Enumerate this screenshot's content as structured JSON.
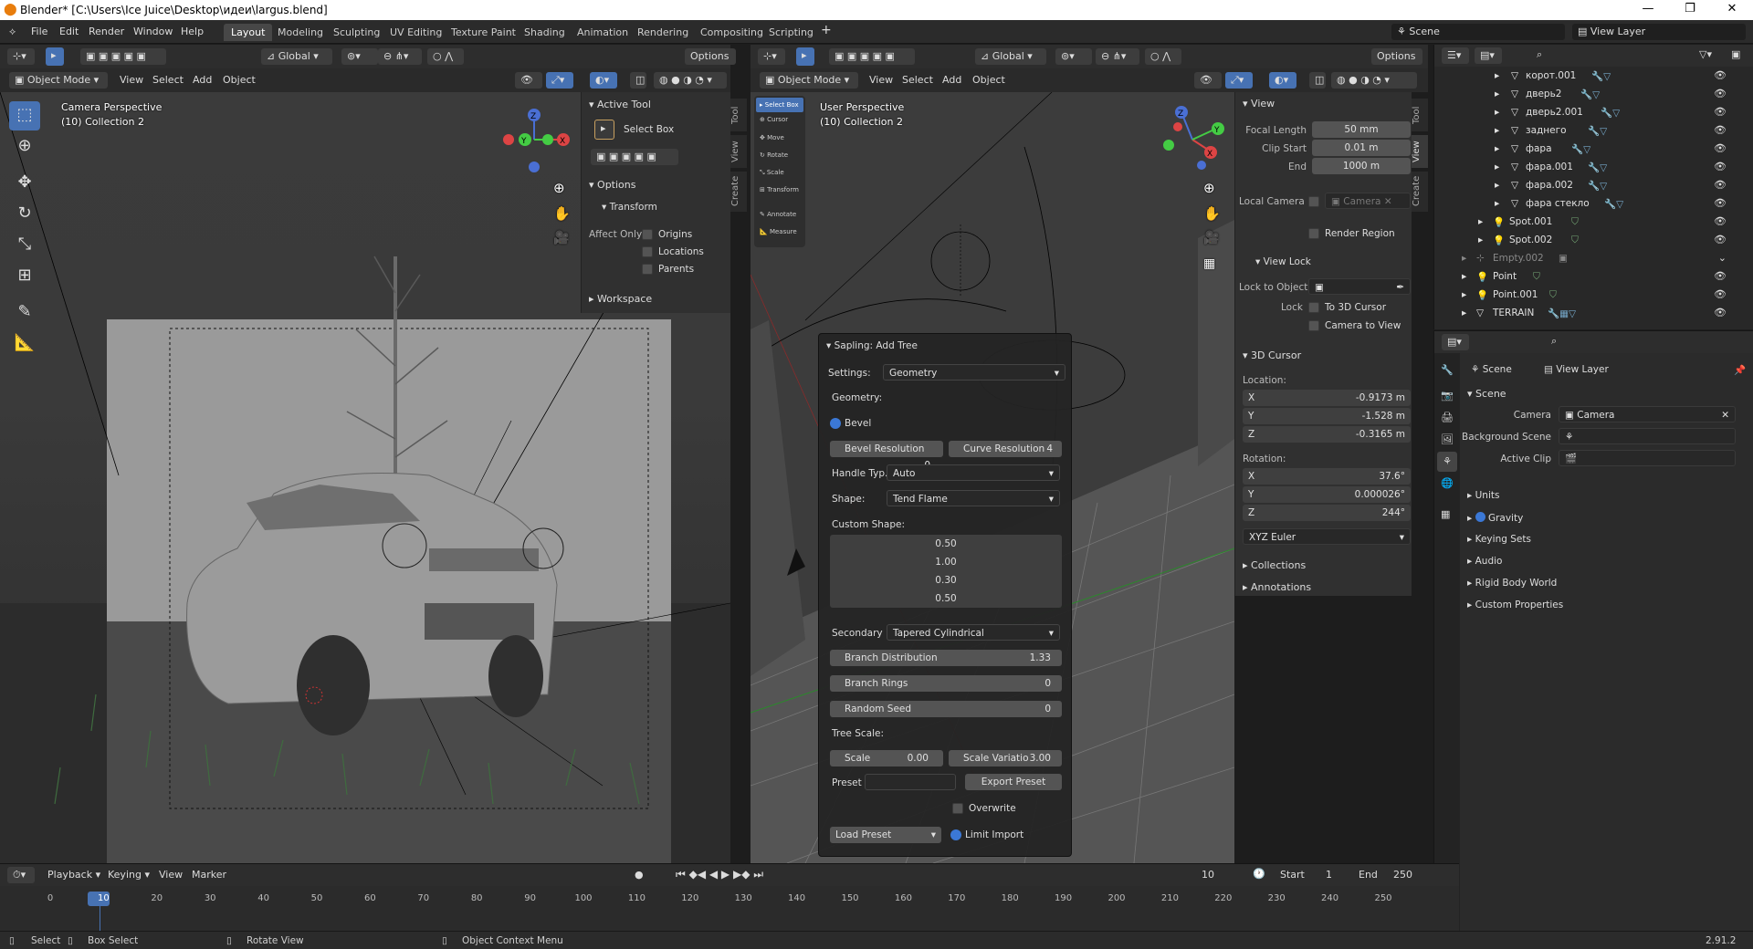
{
  "window": {
    "title": "Blender* [C:\\Users\\Ice Juice\\Desktop\\идеи\\largus.blend]",
    "min_icon": "minimize-icon",
    "max_icon": "maximize-icon",
    "close_icon": "close-icon"
  },
  "menu": {
    "items": [
      "File",
      "Edit",
      "Render",
      "Window",
      "Help"
    ]
  },
  "workspaces": [
    "Layout",
    "Modeling",
    "Sculpting",
    "UV Editing",
    "Texture Paint",
    "Shading",
    "Animation",
    "Rendering",
    "Compositing",
    "Scripting"
  ],
  "top_right": {
    "scene": "Scene",
    "view_layer": "View Layer"
  },
  "left_viewport": {
    "transform": "Global",
    "options": "Options",
    "mode": "Object Mode",
    "menus": [
      "View",
      "Select",
      "Add",
      "Object"
    ],
    "perspective": "Camera Perspective",
    "collection": "(10) Collection 2",
    "tool_panel": {
      "active_tool": "Active Tool",
      "select_box": "Select Box",
      "options": "Options",
      "transform": "Transform",
      "affect_only": "Affect Only",
      "origins": "Origins",
      "locations": "Locations",
      "parents": "Parents",
      "workspace": "Workspace"
    },
    "tabs": [
      "Tool",
      "View",
      "Create"
    ]
  },
  "right_viewport": {
    "transform": "Global",
    "options": "Options",
    "mode": "Object Mode",
    "menus": [
      "View",
      "Select",
      "Add",
      "Object"
    ],
    "perspective": "User Perspective",
    "collection": "(10) Collection 2",
    "mini_tools": [
      "Select Box",
      "Cursor",
      "Move",
      "Rotate",
      "Scale",
      "Transform",
      "Annotate",
      "Measure"
    ],
    "view_panel": {
      "view": "View",
      "focal_length_label": "Focal Length",
      "focal_length": "50 mm",
      "clip_start_label": "Clip Start",
      "clip_start": "0.01 m",
      "end_label": "End",
      "end": "1000 m",
      "local_camera_label": "Local Camera",
      "local_camera": "Camera",
      "render_region": "Render Region",
      "view_lock": "View Lock",
      "lock_to_object_label": "Lock to Object",
      "lock_label": "Lock",
      "to_3d_cursor": "To 3D Cursor",
      "camera_to_view": "Camera to View",
      "cursor_3d": "3D Cursor",
      "location_label": "Location:",
      "loc": [
        {
          "axis": "X",
          "val": "-0.9173 m"
        },
        {
          "axis": "Y",
          "val": "-1.528 m"
        },
        {
          "axis": "Z",
          "val": "-0.3165 m"
        }
      ],
      "rotation_label": "Rotation:",
      "rot": [
        {
          "axis": "X",
          "val": "37.6°"
        },
        {
          "axis": "Y",
          "val": "0.000026°"
        },
        {
          "axis": "Z",
          "val": "244°"
        }
      ],
      "rot_mode": "XYZ Euler",
      "collections": "Collections",
      "annotations": "Annotations"
    },
    "tabs": [
      "Tool",
      "View",
      "Create"
    ]
  },
  "sapling": {
    "title": "Sapling: Add Tree",
    "settings_label": "Settings:",
    "settings": "Geometry",
    "geometry_label": "Geometry:",
    "bevel": "Bevel",
    "bevel_resolution": "Bevel Resolution",
    "bevel_resolution_val": "0",
    "curve_resolution": "Curve Resolution",
    "curve_resolution_val": "4",
    "handle_type_label": "Handle Typ...",
    "handle_type": "Auto",
    "shape_label": "Shape:",
    "shape": "Tend Flame",
    "custom_shape_label": "Custom Shape:",
    "custom_shape": [
      "0.50",
      "1.00",
      "0.30",
      "0.50"
    ],
    "secondary_label": "Secondary",
    "secondary": "Tapered Cylindrical",
    "branch_distribution": "Branch Distribution",
    "branch_distribution_val": "1.33",
    "branch_rings": "Branch Rings",
    "branch_rings_val": "0",
    "random_seed": "Random Seed",
    "random_seed_val": "0",
    "tree_scale_label": "Tree Scale:",
    "scale": "Scale",
    "scale_val": "0.00",
    "scale_variation": "Scale Variatio",
    "scale_variation_val": "3.00",
    "preset_label": "Preset",
    "export_preset": "Export Preset",
    "overwrite": "Overwrite",
    "load_preset": "Load Preset",
    "limit_import": "Limit Import"
  },
  "outliner": {
    "items": [
      {
        "name": "корот.001",
        "indent": 3,
        "eye": "👁"
      },
      {
        "name": "дверь2",
        "indent": 3,
        "eye": "👁"
      },
      {
        "name": "дверь2.001",
        "indent": 3,
        "eye": "👁"
      },
      {
        "name": "заднего",
        "indent": 3,
        "eye": "👁"
      },
      {
        "name": "фара",
        "indent": 3,
        "eye": "👁"
      },
      {
        "name": "фара.001",
        "indent": 3,
        "eye": "👁"
      },
      {
        "name": "фара.002",
        "indent": 3,
        "eye": "👁"
      },
      {
        "name": "фара стекло",
        "indent": 3,
        "eye": "👁"
      },
      {
        "name": "Spot.001",
        "indent": 2,
        "eye": "👁"
      },
      {
        "name": "Spot.002",
        "indent": 2,
        "eye": "👁"
      },
      {
        "name": "Empty.002",
        "indent": 1,
        "eye": "⌄"
      },
      {
        "name": "Point",
        "indent": 1,
        "eye": "👁"
      },
      {
        "name": "Point.001",
        "indent": 1,
        "eye": "👁"
      },
      {
        "name": "TERRAIN",
        "indent": 1,
        "eye": "👁"
      }
    ]
  },
  "properties": {
    "scene_tab": "Scene",
    "view_layer_tab": "View Layer",
    "scene_header": "Scene",
    "camera_label": "Camera",
    "camera": "Camera",
    "background_scene_label": "Background Scene",
    "active_clip_label": "Active Clip",
    "sections": [
      "Units",
      "Gravity",
      "Keying Sets",
      "Audio",
      "Rigid Body World",
      "Custom Properties"
    ]
  },
  "timeline": {
    "menus": [
      "Playback",
      "Keying",
      "View",
      "Marker"
    ],
    "current_frame": "10",
    "start_label": "Start",
    "start": "1",
    "end_label": "End",
    "end": "250",
    "ruler": [
      "0",
      "10",
      "20",
      "30",
      "40",
      "50",
      "60",
      "70",
      "80",
      "90",
      "100",
      "110",
      "120",
      "130",
      "140",
      "150",
      "160",
      "170",
      "180",
      "190",
      "200",
      "210",
      "220",
      "230",
      "240",
      "250"
    ]
  },
  "statusbar": {
    "select": "Select",
    "box_select": "Box Select",
    "rotate_view": "Rotate View",
    "context_menu": "Object Context Menu",
    "version": "2.91.2"
  }
}
